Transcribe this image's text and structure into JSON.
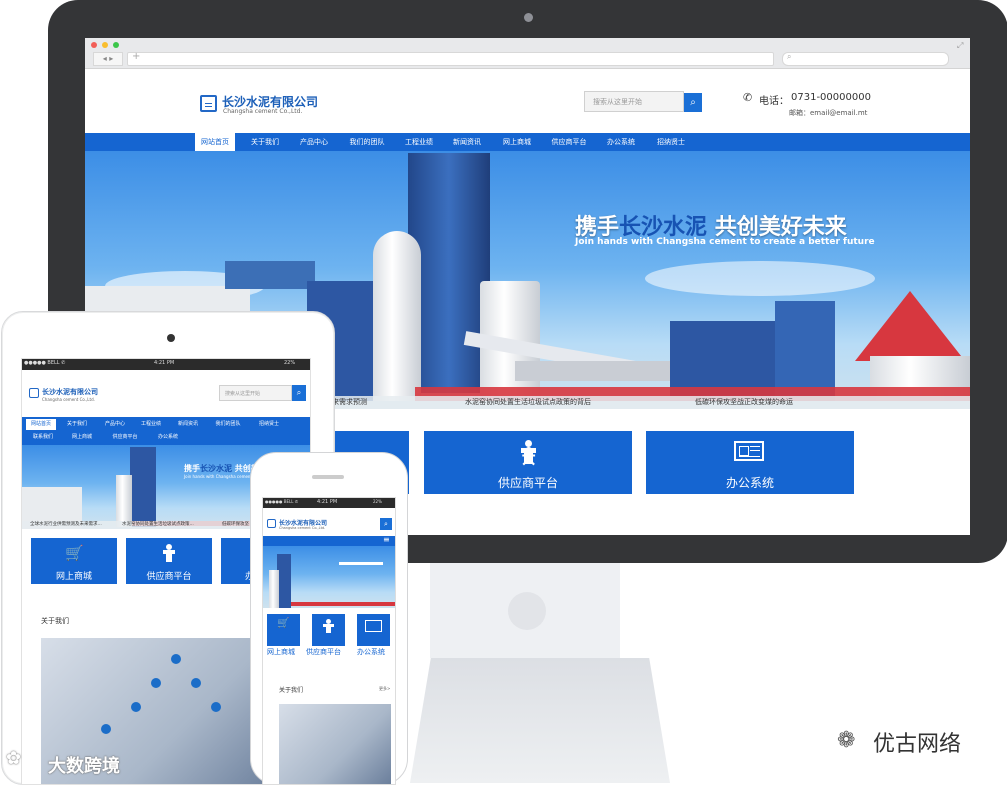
{
  "desktop": {
    "company_name": "长沙水泥有限公司",
    "company_sub": "Changsha cement Co.,Ltd.",
    "search_placeholder": "搜索从这里开始",
    "phone_label": "电话：",
    "phone_value": "0731-00000000",
    "email_line": "邮箱：email@email.mt",
    "nav": [
      "网站首页",
      "关于我们",
      "产品中心",
      "我们的团队",
      "工程业绩",
      "新闻资讯",
      "网上商城",
      "供应商平台",
      "办公系统",
      "招纳贤士"
    ],
    "banner_title_prefix": "携手",
    "banner_title_highlight": "长沙水泥",
    "banner_title_suffix": " 共创美好未来",
    "banner_subtitle": "Join hands with Changsha cement to create a better future",
    "ticker": [
      "未来需求预测",
      "水泥窑协同处置生活垃圾试点政策的背后",
      "低碳环保攻坚战正改变煤的命运"
    ],
    "tiles": [
      {
        "label": "供应商平台",
        "icon": "supplier-icon"
      },
      {
        "label": "办公系统",
        "icon": "office-icon"
      }
    ]
  },
  "tablet": {
    "status_left": "●●●●● BELL ✆",
    "status_time": "4:21 PM",
    "status_right": "22%",
    "company_name": "长沙水泥有限公司",
    "company_sub": "Changsha cement Co.,Ltd.",
    "search_placeholder": "搜索从这里开始",
    "nav_row1": [
      "网站首页",
      "关于我们",
      "产品中心",
      "工程业绩",
      "新闻资讯",
      "我们的团队",
      "招纳贤士"
    ],
    "nav_row2": [
      "联系我们",
      "网上商城",
      "供应商平台",
      "办公系统"
    ],
    "banner_title_prefix": "携手",
    "banner_title_highlight": "长沙水泥",
    "banner_title_suffix": " 共创美",
    "banner_subtitle": "Join hands with Changsha cement to create",
    "ticker": [
      "全球水泥行业供需预测及未来需求...",
      "水泥窑协同处置生活垃圾试点政策...",
      "低碳环保攻坚"
    ],
    "tiles": [
      {
        "label": "网上商城",
        "icon": "cart-icon"
      },
      {
        "label": "供应商平台",
        "icon": "supplier-icon"
      },
      {
        "label": "办",
        "icon": "office-icon"
      }
    ],
    "about_title": "关于我们"
  },
  "phone": {
    "status_left": "●●●●● BELL ✆",
    "status_time": "4:21 PM",
    "status_right": "22%",
    "company_name": "长沙水泥有限公司",
    "company_sub": "Changsha cement Co.,Ltd.",
    "tiles": [
      {
        "label": "网上商城",
        "icon": "cart-icon"
      },
      {
        "label": "供应商平台",
        "icon": "supplier-icon"
      },
      {
        "label": "办公系统",
        "icon": "office-icon"
      }
    ],
    "about_title": "关于我们",
    "more_link": "更多>"
  },
  "watermarks": {
    "left": "大数跨境",
    "right": "优古网络"
  },
  "colors": {
    "brand_blue": "#1565d1",
    "monitor": "#343537"
  }
}
